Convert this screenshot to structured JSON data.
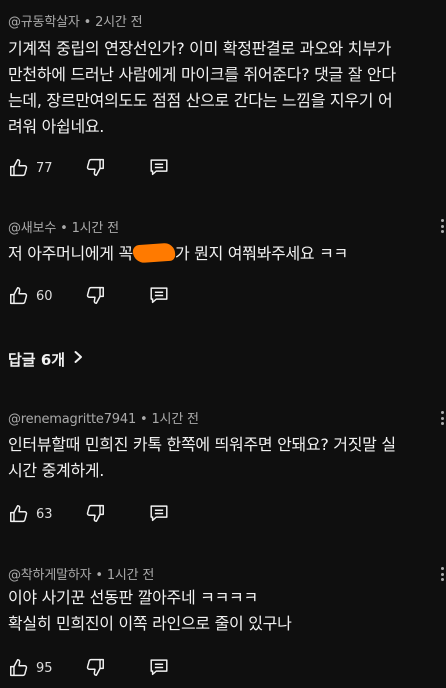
{
  "comments": [
    {
      "author": "@규동학살자",
      "time": "2시간 전",
      "lines": [
        "기계적 중립의 연장선인가? 이미 확정판결로 과오와 치부가",
        "만천하에 드러난 사람에게 마이크를 쥐어준다? 댓글 잘 안다",
        "는데, 장르만여의도도 점점 산으로 간다는 느낌을 지우기 어",
        "려워 아쉽네요."
      ],
      "likes": "77"
    },
    {
      "author": "@새보수",
      "time": "1시간 전",
      "text_before": "저 아주머니에게 꼭",
      "text_after": "가 뭔지 여쭤봐주세요 ㅋㅋ",
      "likes": "60"
    },
    {
      "author": "@renemagritte7941",
      "time": "1시간 전",
      "lines": [
        "인터뷰할때 민희진 카톡 한쪽에 띄워주면 안돼요? 거짓말 실",
        "시간 중계하게."
      ],
      "likes": "63"
    },
    {
      "author": "@착하게말하자",
      "time": "1시간 전",
      "lines": [
        "이야 사기꾼 선동판 깔아주네 ㅋㅋㅋㅋ",
        "확실히 민희진이 이쪽 라인으로 줄이 있구나"
      ],
      "likes": "95"
    }
  ],
  "replies_label": "답글 6개",
  "meta_separator": "•",
  "icons": {
    "like": "thumbs-up-icon",
    "dislike": "thumbs-down-icon",
    "reply": "comment-reply-icon",
    "more": "more-vert-icon",
    "chevron": "chevron-right-icon"
  },
  "colors": {
    "background": "#0f0f0f",
    "text": "#f1f1f1",
    "meta": "#aaaaaa",
    "redaction": "#ff7a00"
  }
}
